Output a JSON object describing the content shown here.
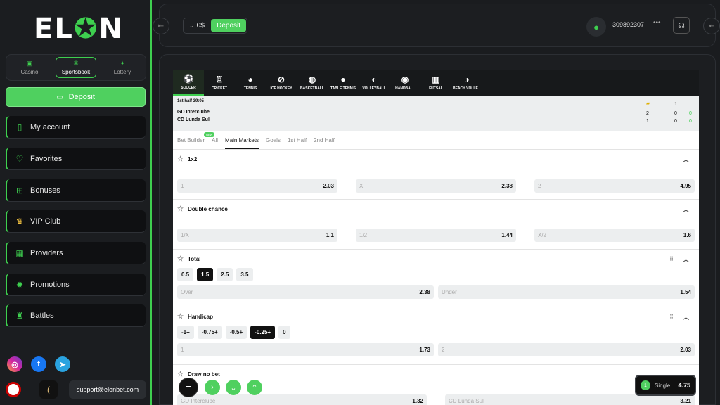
{
  "brand": {
    "logo_left": "EL",
    "logo_mid": "✪",
    "logo_right": "N"
  },
  "product_tabs": [
    {
      "label": "Casino",
      "icon": "casino-icon"
    },
    {
      "label": "Sportsbook",
      "icon": "sportsbook-icon"
    },
    {
      "label": "Lottery",
      "icon": "lottery-icon"
    }
  ],
  "sidebar": {
    "deposit_label": "Deposit",
    "items": [
      {
        "label": "My account",
        "icon": "user-icon"
      },
      {
        "label": "Favorites",
        "icon": "heart-icon"
      },
      {
        "label": "Bonuses",
        "icon": "gift-icon"
      },
      {
        "label": "VIP Club",
        "icon": "crown-icon"
      },
      {
        "label": "Providers",
        "icon": "grid-icon"
      },
      {
        "label": "Promotions",
        "icon": "promo-icon"
      },
      {
        "label": "Battles",
        "icon": "trophy-icon"
      }
    ],
    "support_email": "support@elonbet.com"
  },
  "header": {
    "balance": "0$",
    "deposit_label": "Deposit",
    "user_id": "309892307",
    "more": "•••"
  },
  "sports": [
    "SOCCER",
    "CRICKET",
    "TENNIS",
    "ICE HOCKEY",
    "BASKETBALL",
    "TABLE TENNIS",
    "VOLLEYBALL",
    "HANDBALL",
    "FUTSAL",
    "BEACH VOLLE..."
  ],
  "match": {
    "time": "1st half 39:05",
    "team1": "GD Interclube",
    "team2": "CD Lunda Sul",
    "score_header": "1",
    "row1": [
      "2",
      "0",
      "0"
    ],
    "row2": [
      "1",
      "0",
      "0"
    ]
  },
  "subtabs": [
    "Bet Builder",
    "All",
    "Main Markets",
    "Goals",
    "1st Half",
    "2nd Half"
  ],
  "new_badge": "NEW",
  "markets": {
    "m1x2": {
      "title": "1x2",
      "odds": [
        {
          "label": "1",
          "value": "2.03"
        },
        {
          "label": "X",
          "value": "2.38"
        },
        {
          "label": "2",
          "value": "4.95"
        }
      ]
    },
    "double": {
      "title": "Double chance",
      "odds": [
        {
          "label": "1/X",
          "value": "1.1"
        },
        {
          "label": "1/2",
          "value": "1.44"
        },
        {
          "label": "X/2",
          "value": "1.6"
        }
      ]
    },
    "total": {
      "title": "Total",
      "lines": [
        "0.5",
        "1.5",
        "2.5",
        "3.5"
      ],
      "odds": [
        {
          "label": "Over",
          "value": "2.38"
        },
        {
          "label": "Under",
          "value": "1.54"
        }
      ]
    },
    "handicap": {
      "title": "Handicap",
      "lines": [
        "-1+",
        "-0.75+",
        "-0.5+",
        "-0.25+",
        "0"
      ],
      "odds": [
        {
          "label": "1",
          "value": "1.73"
        },
        {
          "label": "2",
          "value": "2.03"
        }
      ]
    },
    "dnb": {
      "title": "Draw no bet",
      "odds": [
        {
          "label": "GD Interclube",
          "value": "1.32"
        },
        {
          "label": "CD Lunda Sul",
          "value": "3.21"
        }
      ]
    }
  },
  "betslip": {
    "count": "1",
    "label": "Single",
    "odd": "4.75"
  }
}
